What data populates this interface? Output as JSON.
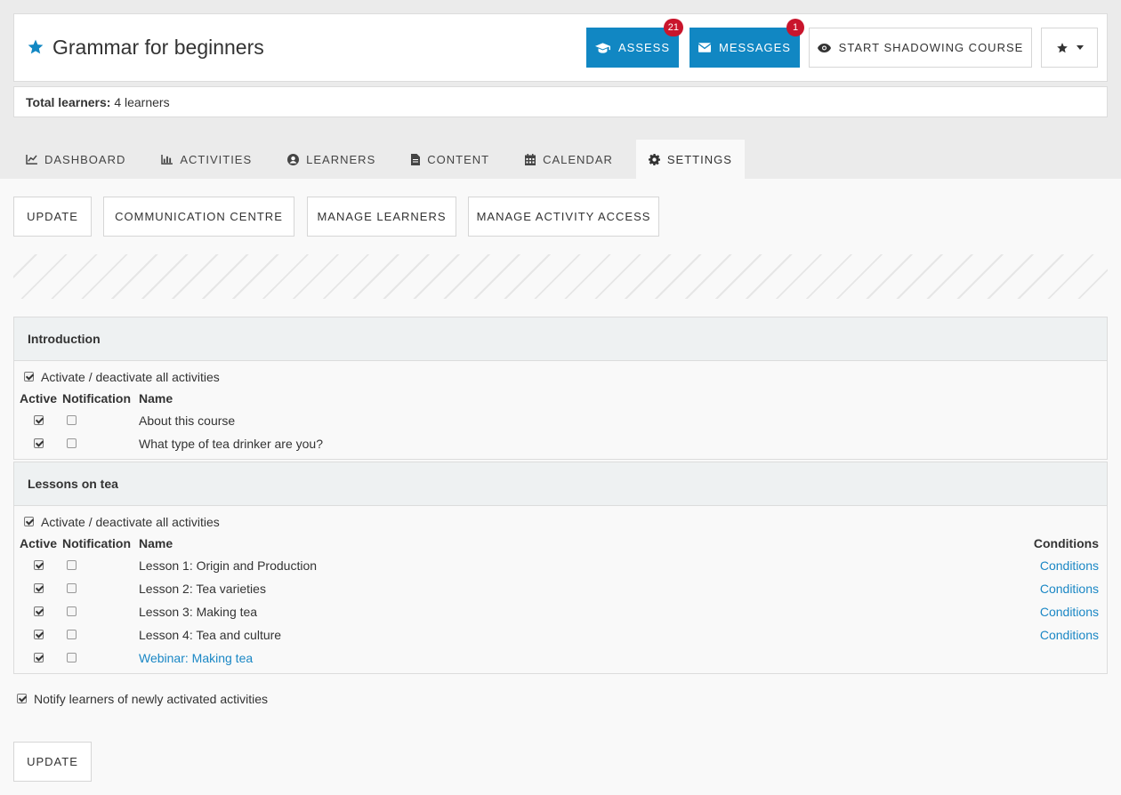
{
  "header": {
    "title": "Grammar for beginners",
    "buttons": {
      "assess": {
        "label": "Assess",
        "badge": "21"
      },
      "messages": {
        "label": "Messages",
        "badge": "1"
      },
      "shadow": {
        "label": "Start shadowing course"
      }
    },
    "icons": [
      "star-icon",
      "graduation-cap-icon",
      "envelope-icon",
      "eye-icon",
      "star-dropdown-icon"
    ]
  },
  "learners": {
    "label": "Total learners:",
    "value": "4 learners"
  },
  "tabs": [
    {
      "label": "Dashboard",
      "icon": "chart-line-icon"
    },
    {
      "label": "Activities",
      "icon": "bar-chart-icon"
    },
    {
      "label": "Learners",
      "icon": "user-circle-icon"
    },
    {
      "label": "Content",
      "icon": "document-icon"
    },
    {
      "label": "Calendar",
      "icon": "calendar-icon"
    },
    {
      "label": "Settings",
      "icon": "gear-icon",
      "active": true
    }
  ],
  "actions": {
    "update": "Update",
    "communication": "Communication centre",
    "manage_learners": "Manage learners",
    "manage_access": "Manage activity access"
  },
  "columns": {
    "active": "Active",
    "notification": "Notification",
    "name": "Name",
    "conditions": "Conditions"
  },
  "sections": [
    {
      "title": "Introduction",
      "toggle_all": "Activate / deactivate all activities",
      "items": [
        {
          "name": "About this course",
          "active": true,
          "notify": false
        },
        {
          "name": "What type of tea drinker are you?",
          "active": true,
          "notify": false
        }
      ]
    },
    {
      "title": "Lessons on tea",
      "toggle_all": "Activate / deactivate all activities",
      "items": [
        {
          "name": "Lesson 1: Origin and Production",
          "active": true,
          "notify": false,
          "conditions": "Conditions"
        },
        {
          "name": "Lesson 2: Tea varieties",
          "active": true,
          "notify": false,
          "conditions": "Conditions"
        },
        {
          "name": "Lesson 3: Making tea",
          "active": true,
          "notify": false,
          "conditions": "Conditions"
        },
        {
          "name": "Lesson 4: Tea and culture",
          "active": true,
          "notify": false,
          "conditions": "Conditions"
        },
        {
          "name": "Webinar: Making tea",
          "active": true,
          "notify": false,
          "link": true
        }
      ]
    }
  ],
  "notify_label": "Notify learners of newly activated activities",
  "colors": {
    "primary": "#1187c3",
    "badge": "#c9152c",
    "link": "#1a87c5",
    "section_head": "#eef1f2"
  }
}
